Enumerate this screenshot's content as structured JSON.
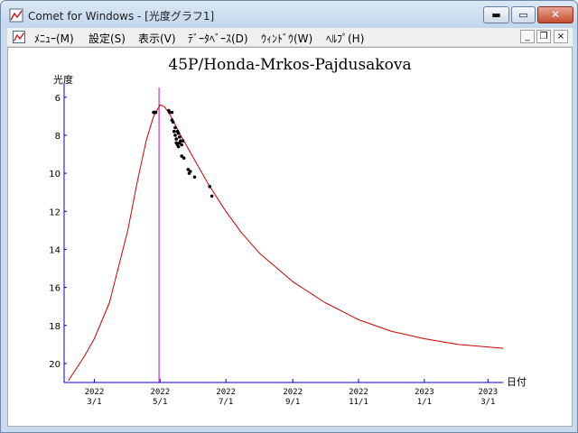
{
  "window": {
    "title": "Comet for Windows - [光度グラフ1]",
    "min_glyph": "▬",
    "max_glyph": "▭",
    "close_glyph": "✕",
    "icon": "graph-doc-icon"
  },
  "menubar": {
    "items": [
      "ﾒﾆｭｰ(M)",
      "設定(S)",
      "表示(V)",
      "ﾃﾞｰﾀﾍﾞｰｽ(D)",
      "ｳｨﾝﾄﾞｳ(W)",
      "ﾍﾙﾌﾟ(H)"
    ],
    "mdi_min": "_",
    "mdi_restore": "❐",
    "mdi_close": "×"
  },
  "colors": {
    "curve": "#cc0000",
    "marker": "#cc00cc",
    "axis": "#0000cc",
    "points": "#000000"
  },
  "chart_data": {
    "type": "scatter",
    "title": "45P/Honda-Mrkos-Pajdusakova",
    "ylabel": "光度",
    "xlabel": "日付",
    "y_inverted": true,
    "ylim": [
      5.3,
      21.0
    ],
    "y_ticks": [
      6,
      8,
      10,
      12,
      14,
      16,
      18,
      20
    ],
    "x_ticks": [
      {
        "year": "2022",
        "date": "3/1"
      },
      {
        "year": "2022",
        "date": "5/1"
      },
      {
        "year": "2022",
        "date": "7/1"
      },
      {
        "year": "2022",
        "date": "9/1"
      },
      {
        "year": "2022",
        "date": "11/1"
      },
      {
        "year": "2023",
        "date": "1/1"
      },
      {
        "year": "2023",
        "date": "3/1"
      }
    ],
    "marker_date": "2022-04-30",
    "curve": [
      [
        "2022-02-05",
        20.9
      ],
      [
        "2022-02-20",
        19.6
      ],
      [
        "2022-03-01",
        18.7
      ],
      [
        "2022-03-15",
        16.8
      ],
      [
        "2022-04-01",
        13.0
      ],
      [
        "2022-04-10",
        10.4
      ],
      [
        "2022-04-18",
        8.3
      ],
      [
        "2022-04-25",
        7.0
      ],
      [
        "2022-05-01",
        6.4
      ],
      [
        "2022-05-05",
        6.5
      ],
      [
        "2022-05-10",
        6.9
      ],
      [
        "2022-05-20",
        8.0
      ],
      [
        "2022-06-01",
        9.2
      ],
      [
        "2022-06-15",
        10.6
      ],
      [
        "2022-07-01",
        12.0
      ],
      [
        "2022-07-15",
        13.1
      ],
      [
        "2022-08-01",
        14.2
      ],
      [
        "2022-09-01",
        15.7
      ],
      [
        "2022-10-01",
        16.8
      ],
      [
        "2022-11-01",
        17.7
      ],
      [
        "2022-12-01",
        18.3
      ],
      [
        "2023-01-01",
        18.7
      ],
      [
        "2023-02-01",
        19.0
      ],
      [
        "2023-03-15",
        19.2
      ]
    ],
    "points": [
      [
        "2022-04-25",
        6.8
      ],
      [
        "2022-04-26",
        6.8
      ],
      [
        "2022-04-27",
        6.8
      ],
      [
        "2022-05-09",
        6.7
      ],
      [
        "2022-05-10",
        6.8
      ],
      [
        "2022-05-12",
        6.8
      ],
      [
        "2022-05-12",
        7.2
      ],
      [
        "2022-05-13",
        7.3
      ],
      [
        "2022-05-14",
        7.8
      ],
      [
        "2022-05-15",
        7.6
      ],
      [
        "2022-05-15",
        8.0
      ],
      [
        "2022-05-16",
        8.2
      ],
      [
        "2022-05-16",
        8.4
      ],
      [
        "2022-05-17",
        7.8
      ],
      [
        "2022-05-17",
        8.5
      ],
      [
        "2022-05-18",
        7.9
      ],
      [
        "2022-05-18",
        8.6
      ],
      [
        "2022-05-19",
        8.1
      ],
      [
        "2022-05-19",
        8.4
      ],
      [
        "2022-05-20",
        8.3
      ],
      [
        "2022-05-21",
        8.5
      ],
      [
        "2022-05-21",
        9.1
      ],
      [
        "2022-05-22",
        8.3
      ],
      [
        "2022-05-23",
        9.2
      ],
      [
        "2022-05-27",
        9.8
      ],
      [
        "2022-05-28",
        10.0
      ],
      [
        "2022-05-29",
        9.9
      ],
      [
        "2022-06-02",
        10.2
      ],
      [
        "2022-06-16",
        10.7
      ],
      [
        "2022-06-18",
        11.2
      ]
    ]
  }
}
